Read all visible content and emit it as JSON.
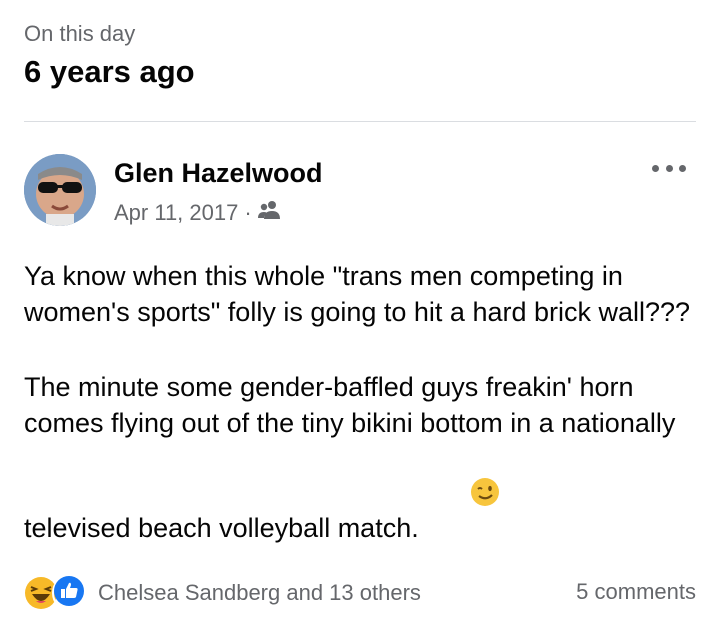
{
  "memory": {
    "kicker": "On this day",
    "headline": "6 years ago"
  },
  "post": {
    "author": "Glen Hazelwood",
    "date": "Apr 11, 2017",
    "separator": "·",
    "audience_icon": "friends-icon",
    "more_icon": "more-options-icon",
    "paragraphs": [
      "Ya know when this whole \"trans men competing in women's sports\" folly is going to hit a hard brick wall???",
      "The minute some gender-baffled guys freakin' horn comes flying out of the tiny bikini bottom in a nationally televised beach volleyball match."
    ],
    "trailing_emoji": "winking-face-emoji"
  },
  "footer": {
    "reaction_icons": [
      "haha-reaction-icon",
      "like-reaction-icon"
    ],
    "reactions_text": "Chelsea Sandberg and 13 others",
    "comments_text": "5 comments"
  },
  "colors": {
    "secondary_text": "#65676b",
    "primary_text": "#050505",
    "like_blue": "#1877f2",
    "haha_yellow": "#f7b928",
    "divider": "#dadde1"
  }
}
